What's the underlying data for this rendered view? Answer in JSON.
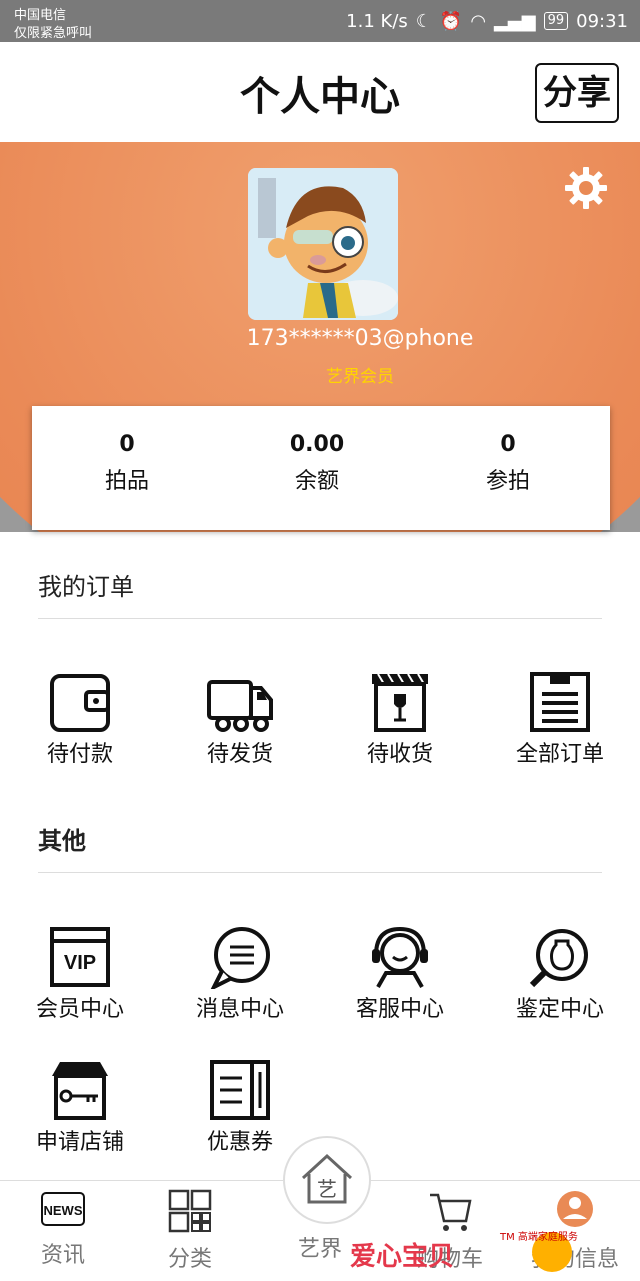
{
  "status_bar": {
    "carrier": "中国电信",
    "emergency": "仅限紧急呼叫",
    "speed": "1.1 K/s",
    "battery": "99",
    "time": "09:31"
  },
  "header": {
    "title": "个人中心",
    "share_label": "分享"
  },
  "profile": {
    "username": "173******03@phone",
    "member_level": "艺界会员"
  },
  "stats": [
    {
      "value": "0",
      "label": "拍品"
    },
    {
      "value": "0.00",
      "label": "余额"
    },
    {
      "value": "0",
      "label": "参拍"
    }
  ],
  "orders": {
    "title": "我的订单",
    "items": [
      {
        "label": "待付款",
        "icon": "wallet-icon"
      },
      {
        "label": "待发货",
        "icon": "truck-icon"
      },
      {
        "label": "待收货",
        "icon": "package-icon"
      },
      {
        "label": "全部订单",
        "icon": "document-icon"
      }
    ]
  },
  "other": {
    "title": "其他",
    "items": [
      {
        "label": "会员中心",
        "icon": "vip-icon"
      },
      {
        "label": "消息中心",
        "icon": "message-icon"
      },
      {
        "label": "客服中心",
        "icon": "customer-service-icon"
      },
      {
        "label": "鉴定中心",
        "icon": "appraisal-icon"
      },
      {
        "label": "申请店铺",
        "icon": "shop-icon"
      },
      {
        "label": "优惠券",
        "icon": "coupon-icon"
      }
    ]
  },
  "bottom_nav": [
    {
      "label": "资讯",
      "icon": "news-icon"
    },
    {
      "label": "分类",
      "icon": "grid-icon"
    },
    {
      "label": "艺界",
      "icon": "home-icon",
      "center_glyph": "艺"
    },
    {
      "label": "购物车",
      "icon": "cart-icon"
    },
    {
      "label": "我的信息",
      "icon": "profile-icon"
    }
  ],
  "watermark": {
    "text": "爱心宝贝",
    "small": "TM 高端家庭服务"
  },
  "colors": {
    "accent_orange": "#e98a55",
    "member_yellow": "#ffd400"
  }
}
